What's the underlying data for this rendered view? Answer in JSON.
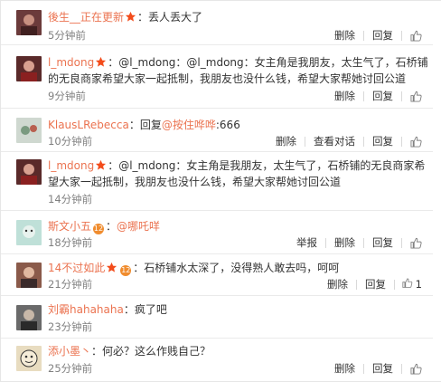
{
  "comments": [
    {
      "user": "後生__正在更新",
      "badge": "star",
      "text": "：丢人丢大了",
      "time": "5分钟前",
      "actions": [
        "删除",
        "回复"
      ],
      "avatar_color": "#6b3b3b"
    },
    {
      "user": "l_mdong",
      "badge": "star",
      "line1": "：@l_mdong：@l_mdong：女主角是我朋友，太生气了，石桥铺",
      "line2": "的无良商家希望大家一起抵制，我朋友也没什么钱，希望大家帮她讨回公道",
      "time": "9分钟前",
      "actions": [
        "删除",
        "回复"
      ],
      "avatar_color": "#7a3a3a"
    },
    {
      "user": "KlausLRebecca",
      "text": "：回复",
      "mention": "@按住哗哗",
      "text2": ":666",
      "time": "10分钟前",
      "actions": [
        "删除",
        "查看对话",
        "回复"
      ],
      "avatar_color": "#9bb0a0"
    },
    {
      "user": "l_mdong",
      "badge": "star",
      "line1": "：@l_mdong：女主角是我朋友，太生气了，石桥铺的无良商家希",
      "line2": "望大家一起抵制，我朋友也没什么钱，希望大家帮她讨回公道",
      "time": "14分钟前",
      "actions": [
        "删除",
        "回复"
      ],
      "avatar_color": "#7a3a3a"
    },
    {
      "user": "斯文小五",
      "badge": "vip",
      "badge_text": "12",
      "text": "：",
      "mention": "@哪吒咩",
      "time": "18分钟前",
      "actions": [
        "举报",
        "删除",
        "回复"
      ],
      "avatar_color": "#a8d0c8"
    },
    {
      "user": "14不过如此",
      "badge": "star+vip",
      "badge_text": "12",
      "text": "：石桥铺水太深了，没得熟人敢去吗，呵呵",
      "time": "21分钟前",
      "actions": [
        "删除",
        "回复"
      ],
      "like_count": "1",
      "avatar_color": "#8a5a4a"
    },
    {
      "user": "刘霸hahahaha",
      "text": "：疯了吧",
      "time": "23分钟前",
      "actions": [
        "删除",
        "回复"
      ],
      "avatar_color": "#5a5a5a"
    },
    {
      "user": "添小墨丶",
      "text": "：何必？这么作贱自己？",
      "time": "25分钟前",
      "actions": [
        "删除",
        "回复"
      ],
      "avatar_color": "#c8b890"
    }
  ],
  "colors": {
    "username": "#eb7350",
    "text": "#333333",
    "time": "#808080",
    "divider": "#eaeaea"
  },
  "icons": {
    "like": "thumbs-up-icon",
    "star": "star-badge-icon",
    "vip": "vip-level-badge"
  }
}
